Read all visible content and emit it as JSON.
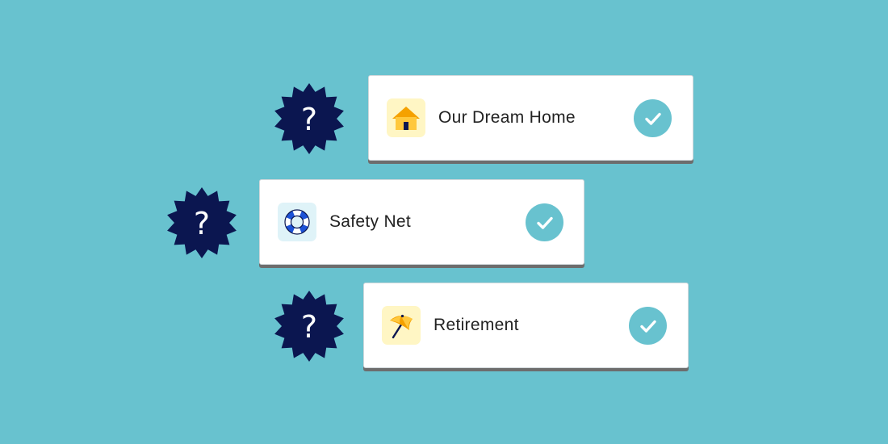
{
  "colors": {
    "background": "#68c2cf",
    "badge": "#0b1650",
    "check_fill": "#68c2cf",
    "home_tile": "#fff6c4",
    "safety_tile": "#dff3f8",
    "retirement_tile": "#fff6c4"
  },
  "badge_symbol": "?",
  "goals": [
    {
      "label": "Our Dream Home",
      "icon": "house-icon"
    },
    {
      "label": "Safety Net",
      "icon": "life-ring-icon"
    },
    {
      "label": "Retirement",
      "icon": "beach-umbrella-icon"
    }
  ]
}
